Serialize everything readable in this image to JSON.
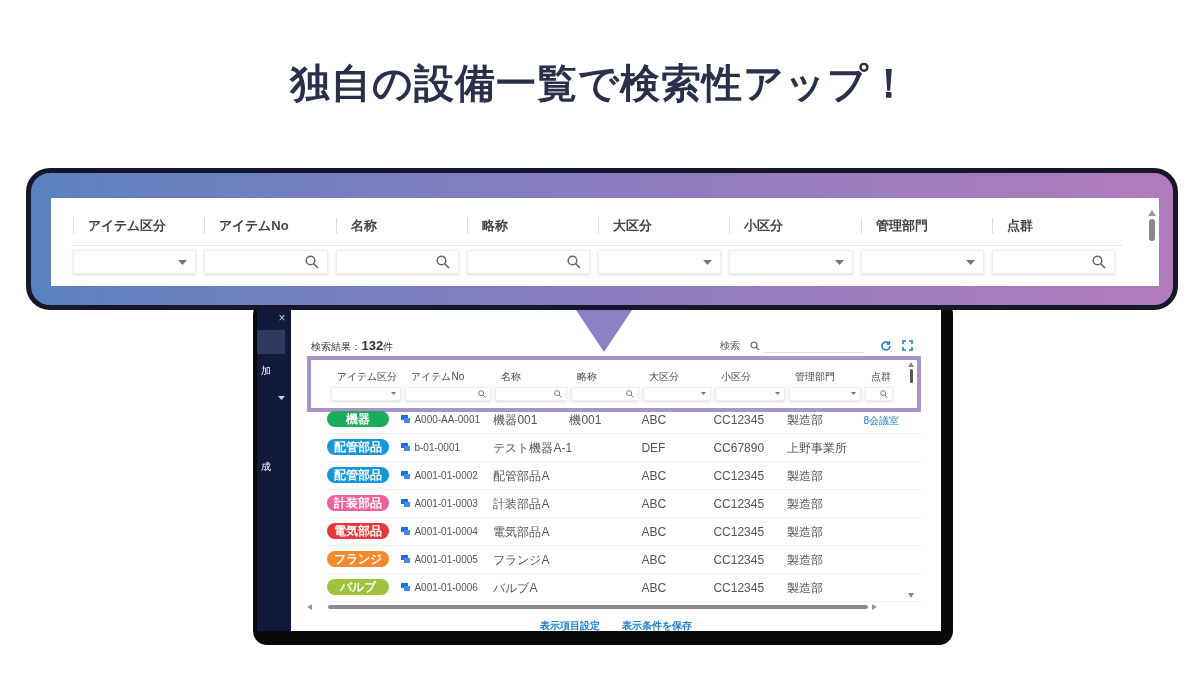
{
  "headline": "独自の設備一覧で検索性アップ！",
  "callout": {
    "columns": [
      {
        "label": "アイテム区分",
        "kind": "select"
      },
      {
        "label": "アイテムNo",
        "kind": "search"
      },
      {
        "label": "名称",
        "kind": "search"
      },
      {
        "label": "略称",
        "kind": "search"
      },
      {
        "label": "大区分",
        "kind": "select"
      },
      {
        "label": "小区分",
        "kind": "select"
      },
      {
        "label": "管理部門",
        "kind": "select"
      },
      {
        "label": "点群",
        "kind": "search"
      }
    ]
  },
  "sidebar": {
    "close": "×",
    "items": [
      {
        "selected": true,
        "kind": "blank"
      },
      {
        "label": "加",
        "selected": false,
        "kind": "text"
      },
      {
        "selected": false,
        "kind": "dropdown"
      },
      {
        "label": "成",
        "selected": false,
        "kind": "text"
      }
    ]
  },
  "toolbar": {
    "result_label": "検索結果：",
    "result_count": "132",
    "result_unit": "件",
    "search_label": "検索"
  },
  "table": {
    "columns": [
      {
        "label": "アイテム区分",
        "kind": "select"
      },
      {
        "label": "アイテムNo",
        "kind": "search"
      },
      {
        "label": "名称",
        "kind": "search"
      },
      {
        "label": "略称",
        "kind": "search"
      },
      {
        "label": "大区分",
        "kind": "select"
      },
      {
        "label": "小区分",
        "kind": "select"
      },
      {
        "label": "管理部門",
        "kind": "select"
      },
      {
        "label": "点群",
        "kind": "search"
      }
    ],
    "rows": [
      {
        "badge": "機器",
        "color": "#1aab5c",
        "item_no": "A000-AA-0001",
        "name": "機器001",
        "abbr": "機001",
        "major": "ABC",
        "minor": "CC12345",
        "dept": "製造部",
        "point_cloud": "8会議室"
      },
      {
        "badge": "配管部品",
        "color": "#1597d9",
        "item_no": "b-01-0001",
        "name": "テスト機器A-1",
        "major": "DEF",
        "minor": "CC67890",
        "dept": "上野事業所"
      },
      {
        "badge": "配管部品",
        "color": "#1597d9",
        "item_no": "A001-01-0002",
        "name": "配管部品A",
        "major": "ABC",
        "minor": "CC12345",
        "dept": "製造部"
      },
      {
        "badge": "計装部品",
        "color": "#f0609a",
        "item_no": "A001-01-0003",
        "name": "計装部品A",
        "major": "ABC",
        "minor": "CC12345",
        "dept": "製造部"
      },
      {
        "badge": "電気部品",
        "color": "#e8383d",
        "item_no": "A001-01-0004",
        "name": "電気部品A",
        "major": "ABC",
        "minor": "CC12345",
        "dept": "製造部"
      },
      {
        "badge": "フランジ",
        "color": "#f68a2e",
        "item_no": "A001-01-0005",
        "name": "フランジA",
        "major": "ABC",
        "minor": "CC12345",
        "dept": "製造部"
      },
      {
        "badge": "バルブ",
        "color": "#9cc33b",
        "item_no": "A001-01-0006",
        "name": "バルブA",
        "major": "ABC",
        "minor": "CC12345",
        "dept": "製造部"
      }
    ]
  },
  "footer": {
    "links": [
      "表示項目設定",
      "表示条件を保存"
    ]
  }
}
